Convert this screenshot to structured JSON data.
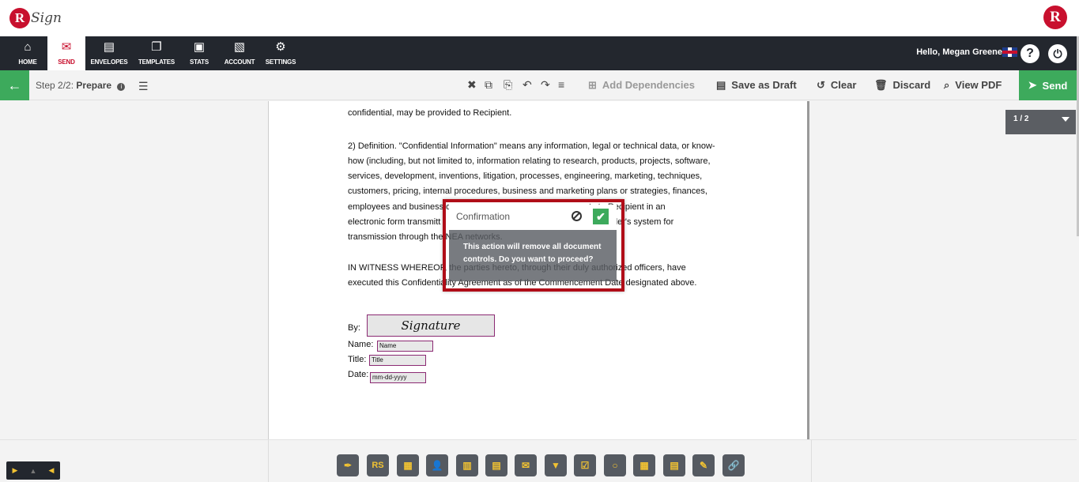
{
  "brand": {
    "logo_letter": "R",
    "logo_text": "Sign",
    "right_logo_letter": "R"
  },
  "nav": {
    "items": [
      {
        "label": "HOME",
        "icon": "⌂"
      },
      {
        "label": "SEND",
        "icon": "✉"
      },
      {
        "label": "ENVELOPES",
        "icon": "▤"
      },
      {
        "label": "TEMPLATES",
        "icon": "❐"
      },
      {
        "label": "STATS",
        "icon": "▣"
      },
      {
        "label": "ACCOUNT",
        "icon": "▧"
      },
      {
        "label": "SETTINGS",
        "icon": "⚙"
      }
    ],
    "greeting": "Hello, Megan Greene",
    "help_glyph": "?",
    "power_glyph": "⏻"
  },
  "toolbar": {
    "back_glyph": "←",
    "step_prefix": "Step 2/2:",
    "step_name": "Prepare",
    "info_glyph": "i",
    "list_glyph": "☰",
    "icons": [
      "✖",
      "⧉",
      "⎘",
      "↶",
      "↷",
      "≡"
    ],
    "add_dependencies": "Add Dependencies",
    "save_draft": "Save as Draft",
    "clear": "Clear",
    "discard": "Discard",
    "view_pdf": "View PDF",
    "send": "Send"
  },
  "document": {
    "lines": [
      "confidential, may be provided to Recipient.",
      "2) Definition.  \"Confidential Information\" means any information, legal or technical data, or know-",
      "how (including, but not limited to, information relating to research, products, projects, software,",
      "services, development, inventions, litigation, processes, engineering, marketing, techniques,",
      "customers, pricing, internal procedures, business and marketing plans or strategies, finances,",
      "employees and business o                                                      arty to Recipient in an",
      "electronic form transmitt                                                       der or sender's system for",
      "transmission through the NEA networks.",
      "IN WITNESS WHEREOF, the parties hereto, through their duly authorized officers, have",
      "executed this Confidentiality Agreement as of the Commencement Date designated above."
    ],
    "by_label": "By:",
    "name_label": "Name:",
    "title_label": "Title:",
    "date_label": "Date:",
    "signature_field": "Signature",
    "name_field": "Name",
    "title_field": "Title",
    "date_field": "mm-dd-yyyy"
  },
  "page_indicator": "1 / 2",
  "modal": {
    "title": "Confirmation",
    "ok_glyph": "✔",
    "message": "This action will remove all document controls. Do you want to proceed?"
  },
  "pager": {
    "first": "▶",
    "up": "▲",
    "prev": "◀"
  },
  "controls": [
    {
      "name": "signature-control",
      "glyph": "✒"
    },
    {
      "name": "initials-control",
      "glyph": "RS"
    },
    {
      "name": "stamp-control",
      "glyph": "▦"
    },
    {
      "name": "name-control",
      "glyph": "👤"
    },
    {
      "name": "company-control",
      "glyph": "▥"
    },
    {
      "name": "title-control",
      "glyph": "▤"
    },
    {
      "name": "email-control",
      "glyph": "✉"
    },
    {
      "name": "dropdown-control",
      "glyph": "▼"
    },
    {
      "name": "checkbox-control",
      "glyph": "☑"
    },
    {
      "name": "radio-control",
      "glyph": "○"
    },
    {
      "name": "date-control",
      "glyph": "▦"
    },
    {
      "name": "text-control",
      "glyph": "▤"
    },
    {
      "name": "label-control",
      "glyph": "✎"
    },
    {
      "name": "hyperlink-control",
      "glyph": "🔗"
    }
  ],
  "colors": {
    "accent_green": "#3daa5c",
    "nav_dark": "#23272e",
    "brand_red": "#c8102e",
    "field_border": "#8b2a73",
    "control_icon": "#f1c232"
  }
}
